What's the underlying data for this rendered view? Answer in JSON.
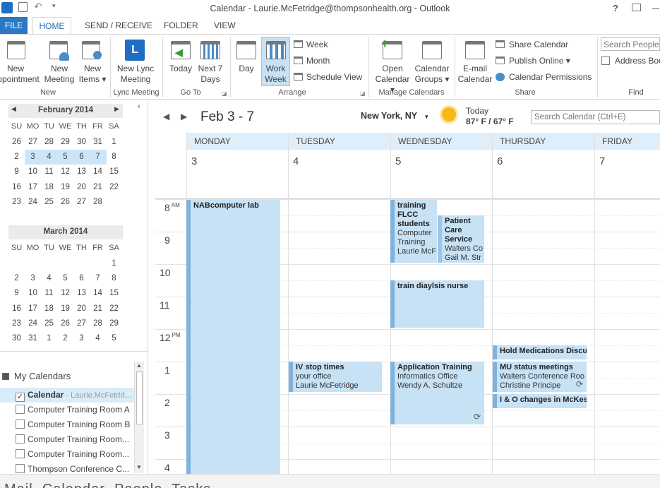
{
  "window": {
    "title": "Calendar - Laurie.McFetridge@thompsonhealth.org - Outlook",
    "help": "?",
    "restore": "▢"
  },
  "tabs": [
    "FILE",
    "HOME",
    "SEND / RECEIVE",
    "FOLDER",
    "VIEW"
  ],
  "ribbon": {
    "new": {
      "new_appointment": "New\nAppointment",
      "new_meeting": "New\nMeeting",
      "new_items": "New\nItems ▾",
      "group": "New"
    },
    "lync": {
      "new_lync_meeting": "New Lync\nMeeting",
      "group": "Lync Meeting"
    },
    "goto": {
      "today": "Today",
      "next7": "Next 7\nDays",
      "group": "Go To"
    },
    "arrange": {
      "day": "Day",
      "work_week": "Work\nWeek",
      "week": "Week",
      "month": "Month",
      "schedule": "Schedule View",
      "group": "Arrange"
    },
    "manage": {
      "open_calendar": "Open\nCalendar ▾",
      "calendar_groups": "Calendar\nGroups ▾",
      "group": "Manage Calendars"
    },
    "share": {
      "email_calendar": "E-mail\nCalendar",
      "share_calendar": "Share Calendar",
      "publish_online": "Publish Online ▾",
      "permissions": "Calendar Permissions",
      "group": "Share"
    },
    "find": {
      "search_people": "Search People",
      "address_book": "Address Boo",
      "group": "Find"
    }
  },
  "mini_cal": {
    "feb": {
      "title": "February 2014",
      "dow": [
        "SU",
        "MO",
        "TU",
        "WE",
        "TH",
        "FR",
        "SA"
      ],
      "weeks": [
        [
          "26",
          "27",
          "28",
          "29",
          "30",
          "31",
          "1"
        ],
        [
          "2",
          "3",
          "4",
          "5",
          "6",
          "7",
          "8"
        ],
        [
          "9",
          "10",
          "11",
          "12",
          "13",
          "14",
          "15"
        ],
        [
          "16",
          "17",
          "18",
          "19",
          "20",
          "21",
          "22"
        ],
        [
          "23",
          "24",
          "25",
          "26",
          "27",
          "28",
          ""
        ]
      ]
    },
    "mar": {
      "title": "March 2014",
      "dow": [
        "SU",
        "MO",
        "TU",
        "WE",
        "TH",
        "FR",
        "SA"
      ],
      "weeks": [
        [
          "",
          "",
          "",
          "",
          "",
          "",
          "1"
        ],
        [
          "2",
          "3",
          "4",
          "5",
          "6",
          "7",
          "8"
        ],
        [
          "9",
          "10",
          "11",
          "12",
          "13",
          "14",
          "15"
        ],
        [
          "16",
          "17",
          "18",
          "19",
          "20",
          "21",
          "22"
        ],
        [
          "23",
          "24",
          "25",
          "26",
          "27",
          "28",
          "29"
        ],
        [
          "30",
          "31",
          "1",
          "2",
          "3",
          "4",
          "5"
        ]
      ]
    }
  },
  "calendars": {
    "header": "My Calendars",
    "items": [
      {
        "name": "Calendar",
        "sub": " - Laurie.McFetrid...",
        "checked": true
      },
      {
        "name": "Computer Training Room A",
        "checked": false
      },
      {
        "name": "Computer Training Room B",
        "checked": false
      },
      {
        "name": "Computer Training Room...",
        "checked": false
      },
      {
        "name": "Computer Training Room...",
        "checked": false
      },
      {
        "name": "Thompson Conference C...",
        "checked": false
      }
    ]
  },
  "bottom_nav": "Mail  Calendar  People  Tasks",
  "calendar": {
    "range": "Feb 3 - 7",
    "location": "New York, NY",
    "weather_day": "Today",
    "weather_temp": "87° F / 67° F",
    "search_placeholder": "Search Calendar (Ctrl+E)",
    "days": [
      {
        "name": "MONDAY",
        "num": "3"
      },
      {
        "name": "TUESDAY",
        "num": "4"
      },
      {
        "name": "WEDNESDAY",
        "num": "5"
      },
      {
        "name": "THURSDAY",
        "num": "6"
      },
      {
        "name": "FRIDAY",
        "num": "7"
      }
    ],
    "hours": [
      {
        "h": "8",
        "ap": "AM"
      },
      {
        "h": "9",
        "ap": ""
      },
      {
        "h": "10",
        "ap": ""
      },
      {
        "h": "11",
        "ap": ""
      },
      {
        "h": "12",
        "ap": "PM"
      },
      {
        "h": "1",
        "ap": ""
      },
      {
        "h": "2",
        "ap": ""
      },
      {
        "h": "3",
        "ap": ""
      },
      {
        "h": "4",
        "ap": ""
      }
    ],
    "appointments": {
      "nab": {
        "title": "NABcomputer lab"
      },
      "ivstop": {
        "title": "IV stop times",
        "loc": "your office",
        "who": "Laurie McFetridge"
      },
      "training": {
        "l1": "training",
        "l2": "FLCC",
        "l3": "students",
        "loc": "Computer",
        "loc2": "Training",
        "who": "Laurie McF"
      },
      "patient": {
        "l1": "Patient",
        "l2": "Care",
        "l3": "Service",
        "loc": "Walters Co",
        "who": "Gail M. Str"
      },
      "dialysis": {
        "title": "train diaylsis nurse"
      },
      "apptrain": {
        "title": "Application Training",
        "loc": "Informatics Office",
        "who": "Wendy A. Schultze"
      },
      "holdmed": {
        "title": "Hold Medications Discu"
      },
      "mustatus": {
        "title": "MU status meetings",
        "loc": "Walters Conference Roo",
        "who": "Christine Principe"
      },
      "io": {
        "title": "I & O changes in McKes"
      }
    }
  }
}
